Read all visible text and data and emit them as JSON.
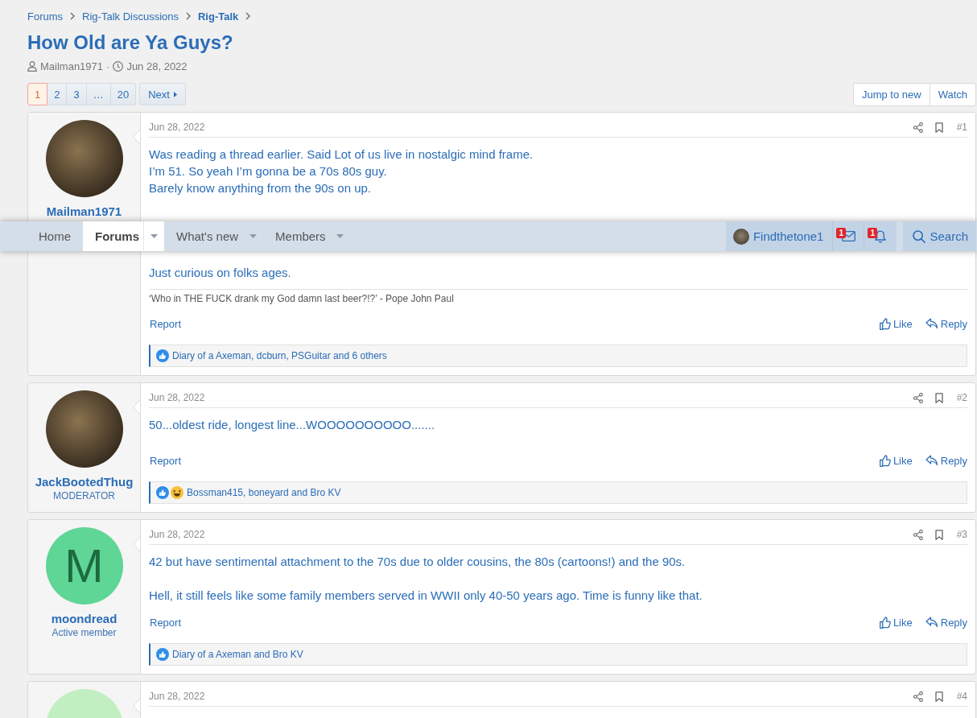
{
  "navbar": {
    "tabs": [
      {
        "label": "Home",
        "selected": false,
        "has_menu": false
      },
      {
        "label": "Forums",
        "selected": true,
        "has_menu": true
      },
      {
        "label": "What's new",
        "selected": false,
        "has_menu": true
      },
      {
        "label": "Members",
        "selected": false,
        "has_menu": true
      }
    ],
    "user": "Findthetone1",
    "alerts": [
      {
        "kind": "inbox",
        "badge": "1"
      },
      {
        "kind": "alerts",
        "badge": "1"
      }
    ],
    "search": "Search"
  },
  "breadcrumbs": [
    {
      "label": "Forums",
      "current": false
    },
    {
      "label": "Rig-Talk Discussions",
      "current": false
    },
    {
      "label": "Rig-Talk",
      "current": true
    }
  ],
  "thread": {
    "title": "How Old are Ya Guys?",
    "author": "Mailman1971",
    "separator": "·",
    "date": "Jun 28, 2022"
  },
  "pagination": {
    "pages": [
      {
        "label": "1",
        "selected": true
      },
      {
        "label": "2",
        "selected": false
      },
      {
        "label": "3",
        "selected": false
      },
      {
        "label": "…",
        "selected": false
      },
      {
        "label": "20",
        "selected": false
      }
    ],
    "next": "Next"
  },
  "thread_actions": [
    "Jump to new",
    "Watch"
  ],
  "posts": [
    {
      "author": "Mailman1971",
      "avatar": {
        "kind": "photo"
      },
      "date": "Jun 28, 2022",
      "number": "#1",
      "paragraphs": [
        "Was reading a thread earlier. Said Lot of us live in nostalgic mind frame.\nI’m 51. So yeah I’m gonna be a 70s 80s guy.\nBarely know anything from the 90s on up.",
        "Just curious on folks ages."
      ],
      "signature": "‘Who in THE FUCK drank my God damn last beer?!?’ - Pope John Paul",
      "report": "Report",
      "actions": [
        {
          "kind": "like",
          "label": "Like"
        },
        {
          "kind": "reply",
          "label": "Reply"
        }
      ],
      "reactions": {
        "icons": [
          {
            "kind": "like"
          }
        ],
        "text": "Diary of a Axeman, dcburn, PSGuitar and 6 others"
      }
    },
    {
      "author": "JackBootedThug",
      "user_title": "MODERATOR",
      "avatar": {
        "kind": "photo"
      },
      "date": "Jun 28, 2022",
      "number": "#2",
      "paragraphs": [
        "50...oldest ride, longest line...WOOOOOOOOOO......."
      ],
      "report": "Report",
      "actions": [
        {
          "kind": "like",
          "label": "Like"
        },
        {
          "kind": "reply",
          "label": "Reply"
        }
      ],
      "reactions": {
        "icons": [
          {
            "kind": "like"
          },
          {
            "kind": "haha"
          }
        ],
        "text": "Bossman415, boneyard and Bro KV"
      }
    },
    {
      "author": "moondread",
      "user_title": "Active member",
      "avatar": {
        "kind": "letter",
        "letter": "M",
        "color": "#5fd596"
      },
      "date": "Jun 28, 2022",
      "number": "#3",
      "paragraphs": [
        "42 but have sentimental attachment to the 70s due to older cousins, the 80s (cartoons!) and the 90s.",
        "Hell, it still feels like some family members served in WWII only 40-50 years ago. Time is funny like that."
      ],
      "report": "Report",
      "actions": [
        {
          "kind": "like",
          "label": "Like"
        },
        {
          "kind": "reply",
          "label": "Reply"
        }
      ],
      "reactions": {
        "icons": [
          {
            "kind": "like"
          }
        ],
        "text": "Diary of a Axeman and Bro KV"
      }
    },
    {
      "avatar": {
        "kind": "letter",
        "color": "#c2efc2"
      },
      "date": "Jun 28, 2022",
      "number": "#4"
    }
  ]
}
